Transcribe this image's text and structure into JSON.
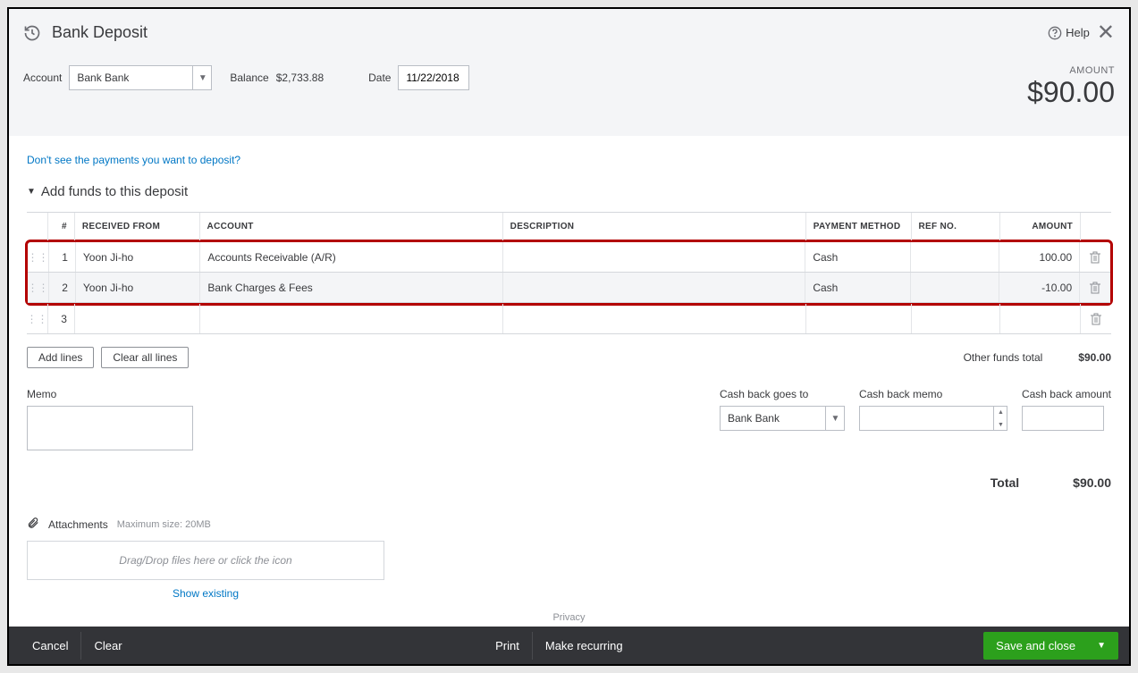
{
  "header": {
    "title": "Bank Deposit",
    "help": "Help"
  },
  "account": {
    "label": "Account",
    "value": "Bank Bank"
  },
  "balance": {
    "label": "Balance",
    "value": "$2,733.88"
  },
  "date": {
    "label": "Date",
    "value": "11/22/2018"
  },
  "amount": {
    "label": "AMOUNT",
    "value": "$90.00"
  },
  "link_payments": "Don't see the payments you want to deposit?",
  "section_title": "Add funds to this deposit",
  "table": {
    "headers": {
      "num": "#",
      "received": "RECEIVED FROM",
      "account": "ACCOUNT",
      "description": "DESCRIPTION",
      "payment": "PAYMENT METHOD",
      "ref": "REF NO.",
      "amount": "AMOUNT"
    },
    "rows": [
      {
        "num": "1",
        "received": "Yoon Ji-ho",
        "account": "Accounts Receivable (A/R)",
        "description": "",
        "payment": "Cash",
        "ref": "",
        "amount": "100.00"
      },
      {
        "num": "2",
        "received": "Yoon Ji-ho",
        "account": "Bank Charges & Fees",
        "description": "",
        "payment": "Cash",
        "ref": "",
        "amount": "-10.00"
      },
      {
        "num": "3",
        "received": "",
        "account": "",
        "description": "",
        "payment": "",
        "ref": "",
        "amount": ""
      }
    ]
  },
  "buttons": {
    "add_lines": "Add lines",
    "clear_lines": "Clear all lines"
  },
  "other_total": {
    "label": "Other funds total",
    "value": "$90.00"
  },
  "memo": {
    "label": "Memo"
  },
  "cashback": {
    "goes_to_label": "Cash back goes to",
    "goes_to_value": "Bank Bank",
    "memo_label": "Cash back memo",
    "amount_label": "Cash back amount"
  },
  "total": {
    "label": "Total",
    "value": "$90.00"
  },
  "attachments": {
    "label": "Attachments",
    "max": "Maximum size: 20MB",
    "drop": "Drag/Drop files here or click the icon",
    "show": "Show existing"
  },
  "privacy": "Privacy",
  "footer": {
    "cancel": "Cancel",
    "clear": "Clear",
    "print": "Print",
    "recurring": "Make recurring",
    "save": "Save and close"
  }
}
